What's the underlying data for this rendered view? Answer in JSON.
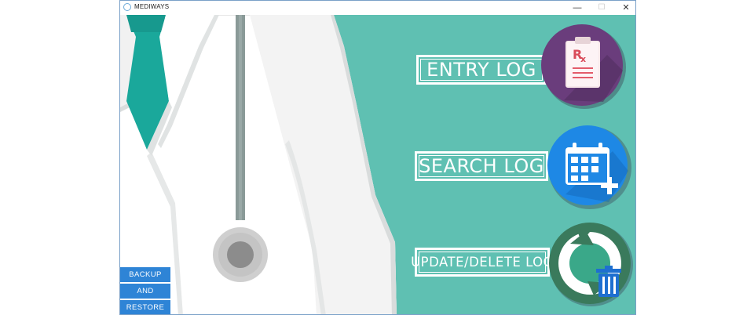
{
  "window": {
    "title": "MEDIWAYS",
    "minimize_glyph": "—",
    "maximize_glyph": "☐",
    "close_glyph": "✕"
  },
  "menu": {
    "entry_log": {
      "label": "ENTRY LOG",
      "icon": "prescription-clipboard-icon",
      "circle_color": "#6a3d7c"
    },
    "search_log": {
      "label": "SEARCH LOG",
      "icon": "calendar-add-icon",
      "circle_color": "#1e88e5"
    },
    "update_delete_log": {
      "label": "UPDATE/DELETE LOG",
      "icon": "refresh-trash-icon",
      "circle_color": "#3a7a5c"
    }
  },
  "backup": {
    "line1": "BACKUP",
    "line2": "AND",
    "line3": "RESTORE"
  },
  "colors": {
    "teal_background": "#5fc0b2",
    "tie": "#1aa89b",
    "stethoscope_tube": "#8a9a98",
    "backup_button": "#2e84d6"
  }
}
